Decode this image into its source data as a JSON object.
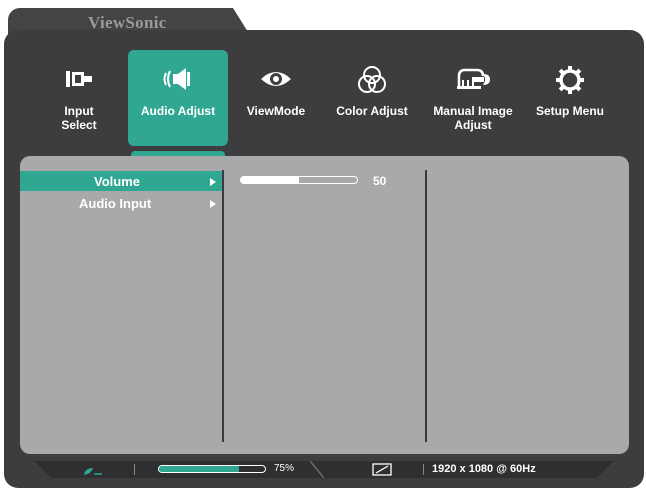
{
  "brand": {
    "name": "ViewSonic"
  },
  "menu": [
    {
      "id": "input-select",
      "label": "Input\nSelect",
      "icon": "input-plug-icon",
      "active": false
    },
    {
      "id": "audio-adjust",
      "label": "Audio Adjust",
      "icon": "speaker-icon",
      "active": true
    },
    {
      "id": "viewmode",
      "label": "ViewMode",
      "icon": "eye-icon",
      "active": false
    },
    {
      "id": "color-adjust",
      "label": "Color Adjust",
      "icon": "color-circles-icon",
      "active": false
    },
    {
      "id": "manual-image-adjust",
      "label": "Manual Image\nAdjust",
      "icon": "wrench-monitor-icon",
      "active": false
    },
    {
      "id": "setup-menu",
      "label": "Setup Menu",
      "icon": "gear-icon",
      "active": false
    }
  ],
  "submenu": {
    "items": [
      {
        "label": "Volume",
        "selected": true
      },
      {
        "label": "Audio Input",
        "selected": false
      }
    ]
  },
  "volume": {
    "value": "50",
    "fraction": 0.5
  },
  "status": {
    "brightness_label": "75%",
    "brightness_fraction": 0.75,
    "resolution": "1920 x 1080 @ 60Hz",
    "eco_icon": "eco-leaf-icon",
    "aspect_icon": "aspect-ratio-icon"
  },
  "colors": {
    "accent": "#2fa793",
    "frame": "#3d3d40",
    "panel": "#a9a9ac",
    "text": "#ffffff"
  }
}
